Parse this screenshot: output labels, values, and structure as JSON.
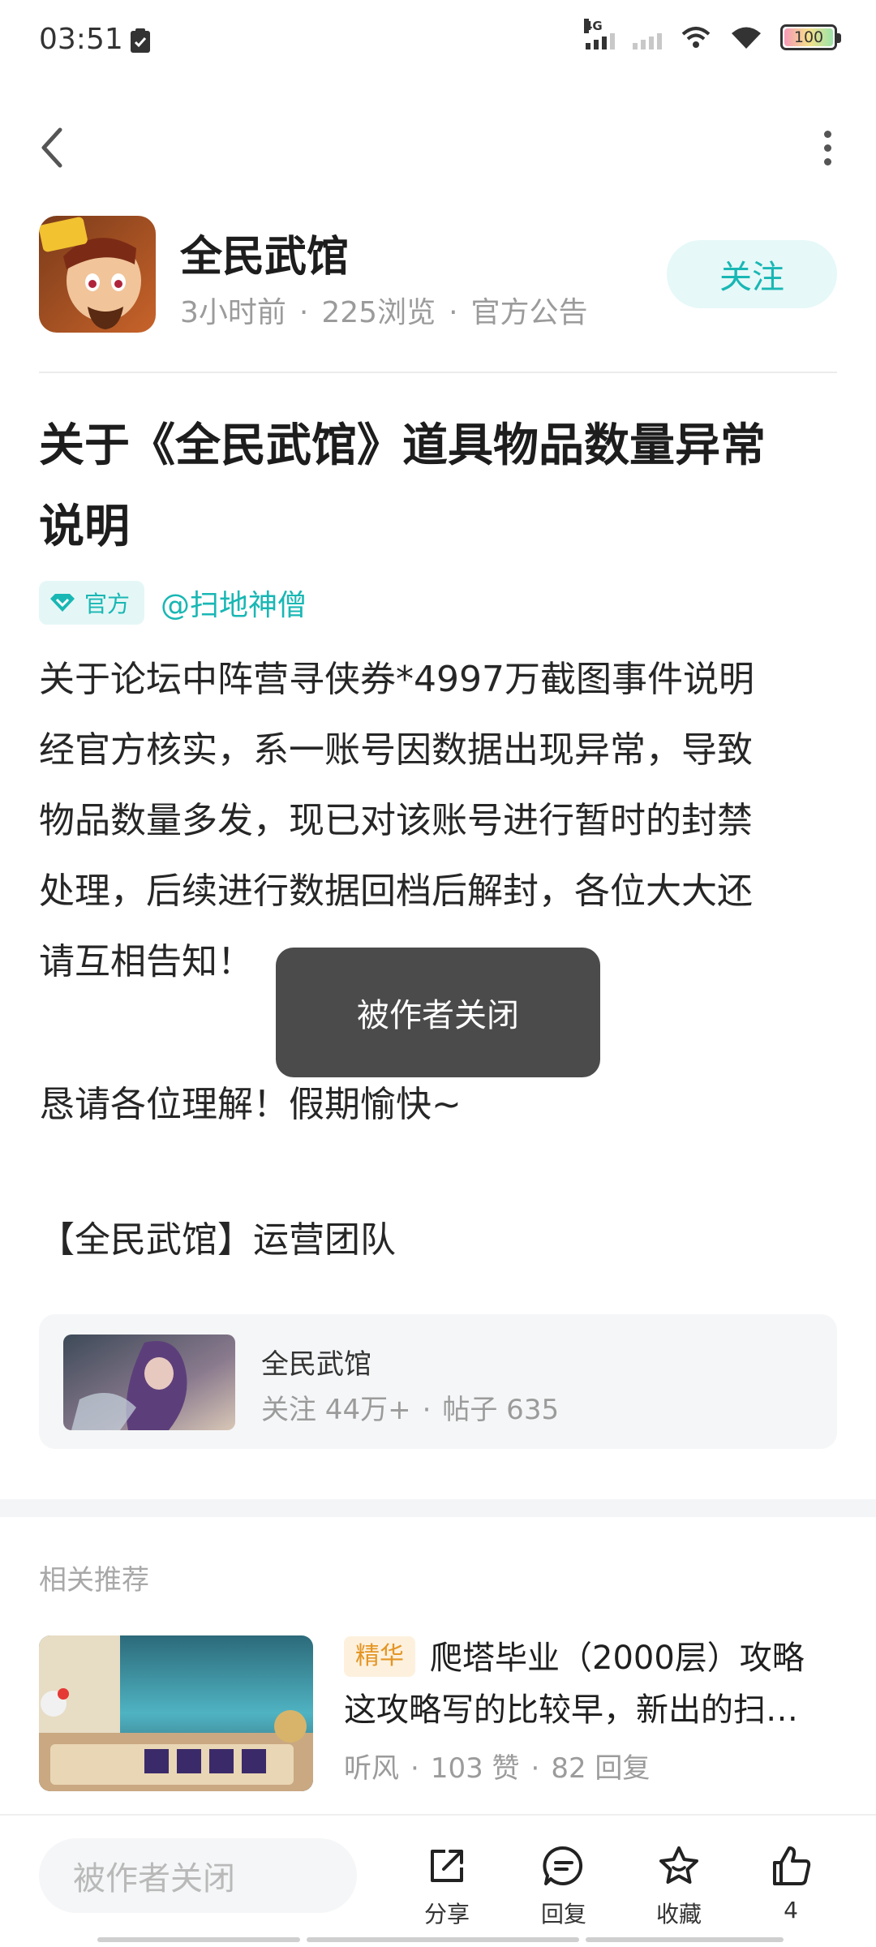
{
  "status_bar": {
    "time": "03:51",
    "network_label": "4G",
    "battery_level": "100"
  },
  "post": {
    "author_name": "全民武馆",
    "time_ago": "3小时前",
    "views": "225浏览",
    "category": "官方公告",
    "follow_label": "关注",
    "title_line1": "关于《全民武馆》道具物品数量异常",
    "title_line2": "说明",
    "official_tag": "官方",
    "mention": "@扫地神僧",
    "body_lines": [
      "关于论坛中阵营寻侠券*4997万截图事件说明",
      "经官方核实，系一账号因数据出现异常，导致",
      "物品数量多发，现已对该账号进行暂时的封禁",
      "处理，后续进行数据回档后解封，各位大大还",
      "请互相告知！"
    ],
    "body_tail": "恳请各位理解！假期愉快~",
    "signature": "【全民武馆】运营团队"
  },
  "toast": {
    "text": "被作者关闭"
  },
  "forum_card": {
    "name": "全民武馆",
    "followers": "关注 44万+",
    "posts": "帖子 635"
  },
  "related": {
    "section_label": "相关推荐",
    "item": {
      "tag": "精华",
      "title_line1": "爬塔毕业（2000层）攻略",
      "title_line2": "这攻略写的比较早，新出的扫…",
      "author": "听风",
      "likes": "103 赞",
      "replies": "82 回复"
    }
  },
  "bottom_bar": {
    "reply_placeholder": "被作者关闭",
    "share_label": "分享",
    "reply_label": "回复",
    "favorite_label": "收藏",
    "like_count": "4"
  },
  "colors": {
    "accent_teal": "#19b7b4",
    "essence_orange": "#e49524",
    "toast_bg": "#4b4b4b"
  }
}
